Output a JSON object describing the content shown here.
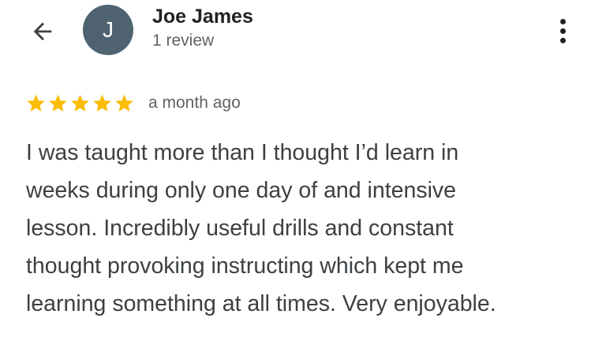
{
  "header": {
    "reviewer_name": "Joe James",
    "avatar_initial": "J",
    "review_count": "1 review",
    "back_icon": "arrow-back-icon",
    "more_icon": "more-vert-icon"
  },
  "review": {
    "rating": 5,
    "rating_max": 5,
    "date": "a month ago",
    "lines": [
      "I was taught more than I thought I’d learn in",
      "weeks during only one day of and intensive",
      "lesson. Incredibly useful drills and constant",
      "thought provoking instructing which kept me",
      "learning something at all times. Very enjoyable."
    ]
  },
  "colors": {
    "star": "#fbbc04",
    "avatar_bg": "#4f6270",
    "text": "#3c4043",
    "secondary_text": "#5f6368"
  }
}
